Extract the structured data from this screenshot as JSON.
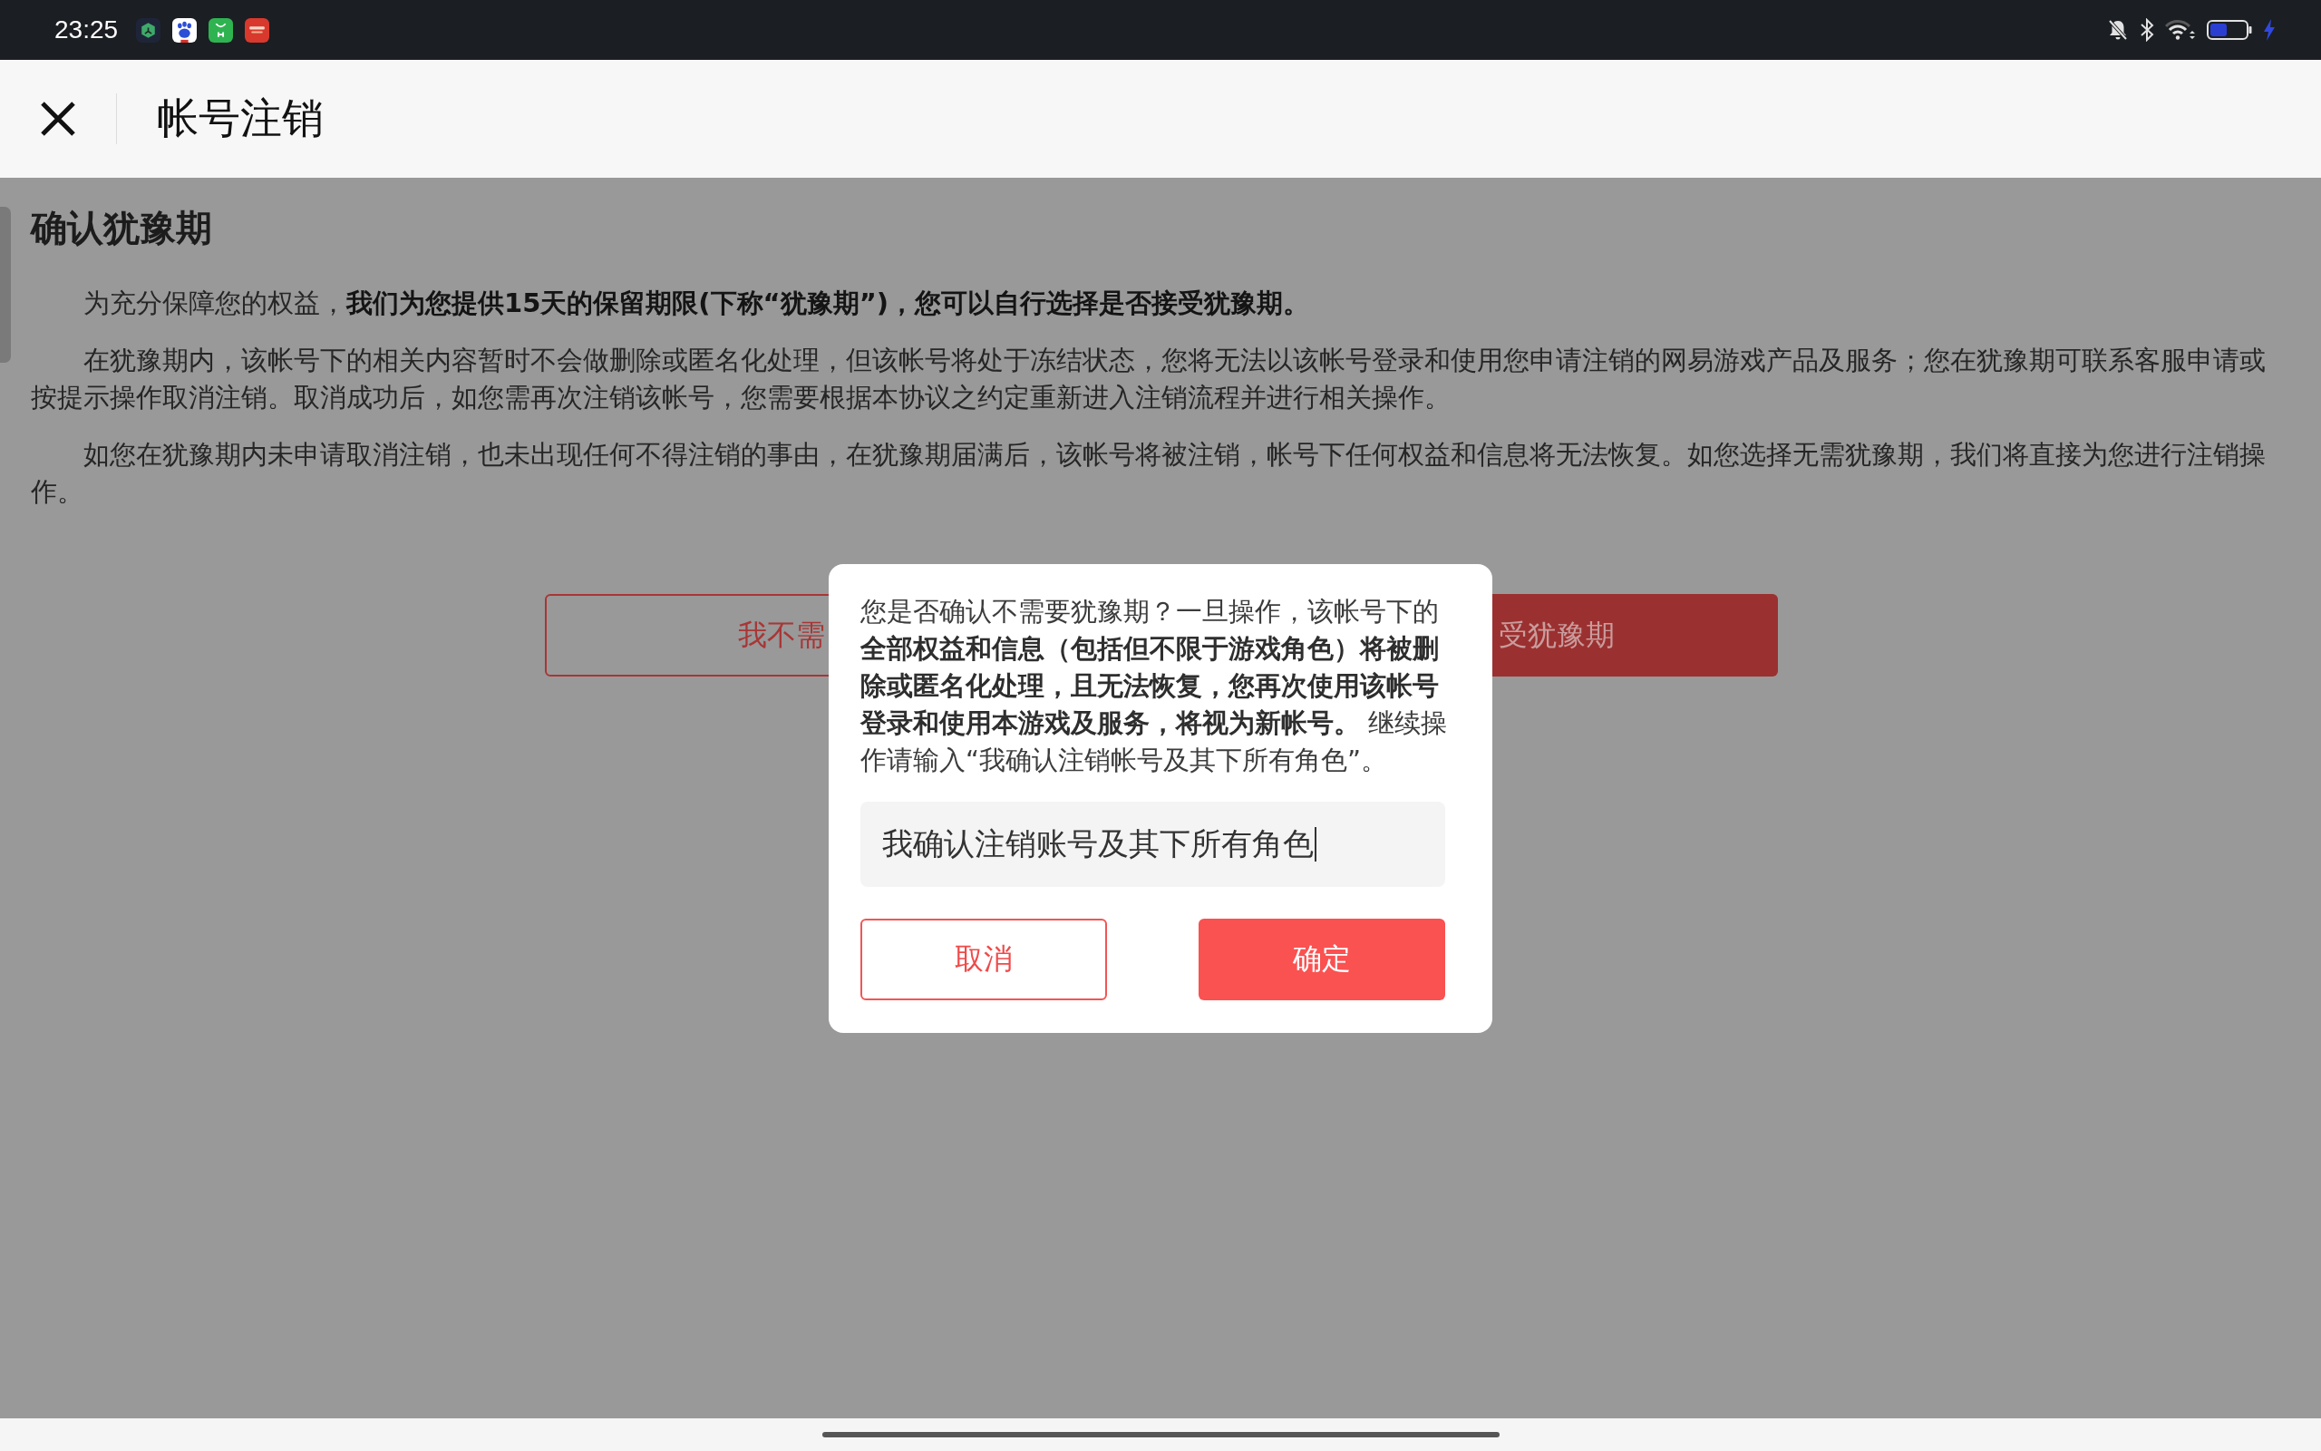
{
  "status_bar": {
    "time": "23:25"
  },
  "header": {
    "title": "帐号注销"
  },
  "content": {
    "heading": "确认犹豫期",
    "paragraphs": [
      "为充分保障您的权益，**我们为您提供15天的保留期限(下称“犹豫期”)，您可以自行选择是否接受犹豫期。**",
      "在犹豫期内，该帐号下的相关内容暂时不会做删除或匿名化处理，但该帐号将处于冻结状态，您将无法以该帐号登录和使用您申请注销的网易游戏产品及服务；您在犹豫期可联系客服申请或按提示操作取消注销。取消成功后，如您需再次注销该帐号，您需要根据本协议之约定重新进入注销流程并进行相关操作。",
      "如您在犹豫期内未申请取消注销，也未出现任何不得注销的事由，在犹豫期届满后，该帐号将被注销，帐号下任何权益和信息将无法恢复。如您选择无需犹豫期，我们将直接为您进行注销操作。"
    ],
    "buttons": [
      {
        "label": "我不需",
        "kind": "outline"
      },
      {
        "label": "受犹豫期",
        "kind": "filled"
      }
    ]
  },
  "dialog": {
    "message": "您是否确认不需要犹豫期？一旦操作，该帐号下的**全部权益和信息（包括但不限于游戏角色）将被删除或匿名化处理，且无法恢复，您再次使用该帐号登录和使用本游戏及服务，将视为新帐号。** 继续操作请输入“我确认注销帐号及其下所有角色”。",
    "input": {
      "value": "我确认注销账号及其下所有角色"
    },
    "buttons": [
      {
        "label": "取消",
        "kind": "outline"
      },
      {
        "label": "确定",
        "kind": "filled"
      }
    ]
  }
}
